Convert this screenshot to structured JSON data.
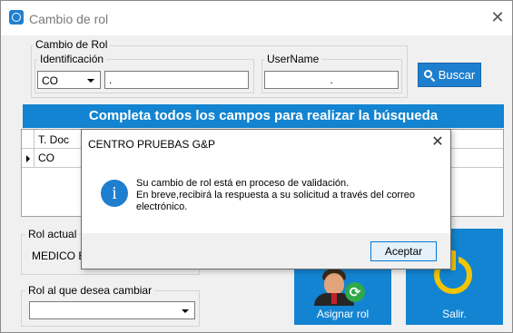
{
  "window": {
    "title": "Cambio de rol"
  },
  "cambio_rol": {
    "group_label": "Cambio de Rol",
    "identificacion_label": "Identificación",
    "identificacion_type": "CO",
    "identificacion_value": ".",
    "username_label": "UserName",
    "username_value": ".",
    "search_label": "Buscar"
  },
  "banner": "Completa todos los campos para realizar la búsqueda",
  "grid": {
    "columns": [
      "T. Doc"
    ],
    "rows": [
      [
        "CO"
      ]
    ]
  },
  "rol_actual": {
    "label": "Rol actual",
    "value": "MEDICO E"
  },
  "rol_cambiar": {
    "label": "Rol al que desea cambiar",
    "value": ""
  },
  "tiles": {
    "assign_label": "Asignar rol",
    "exit_label": "Salir."
  },
  "dialog": {
    "title": "CENTRO PRUEBAS G&P",
    "message_line1": "Su cambio de rol está en proceso de validación.",
    "message_line2": "En breve,recibirá la respuesta a su solicitud a través del correo electrónico.",
    "ok_label": "Aceptar",
    "icon": "info-icon"
  },
  "colors": {
    "accent": "#1384d1",
    "button": "#1f7fcf"
  }
}
